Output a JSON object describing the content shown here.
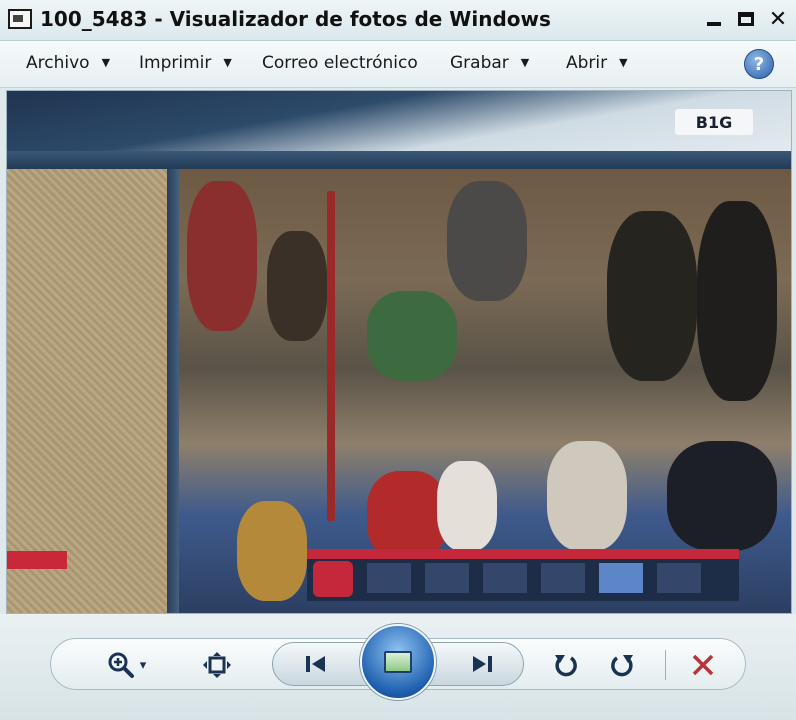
{
  "window": {
    "title": "100_5483 - Visualizador de fotos de Windows",
    "controls": {
      "minimize": "_",
      "maximize": "□",
      "close": "✕"
    }
  },
  "menu": {
    "items": [
      {
        "label": "Archivo",
        "has_dropdown": true
      },
      {
        "label": "Imprimir",
        "has_dropdown": true
      },
      {
        "label": "Correo electrónico",
        "has_dropdown": false
      },
      {
        "label": "Grabar",
        "has_dropdown": true
      },
      {
        "label": "Abrir",
        "has_dropdown": true
      }
    ],
    "help": "?"
  },
  "photo": {
    "broadcast_logo": "B1G",
    "colors": {
      "team_red": "#c4283a",
      "score_bar": "#1d2d48"
    }
  },
  "toolbar": {
    "zoom_caret": "▾",
    "icons": [
      "zoom-icon",
      "actual-size-icon",
      "previous-icon",
      "slideshow-icon",
      "next-icon",
      "rotate-left-icon",
      "rotate-right-icon",
      "delete-icon"
    ],
    "colors": {
      "accent": "#1f5fae",
      "delete": "#b8343a"
    }
  }
}
